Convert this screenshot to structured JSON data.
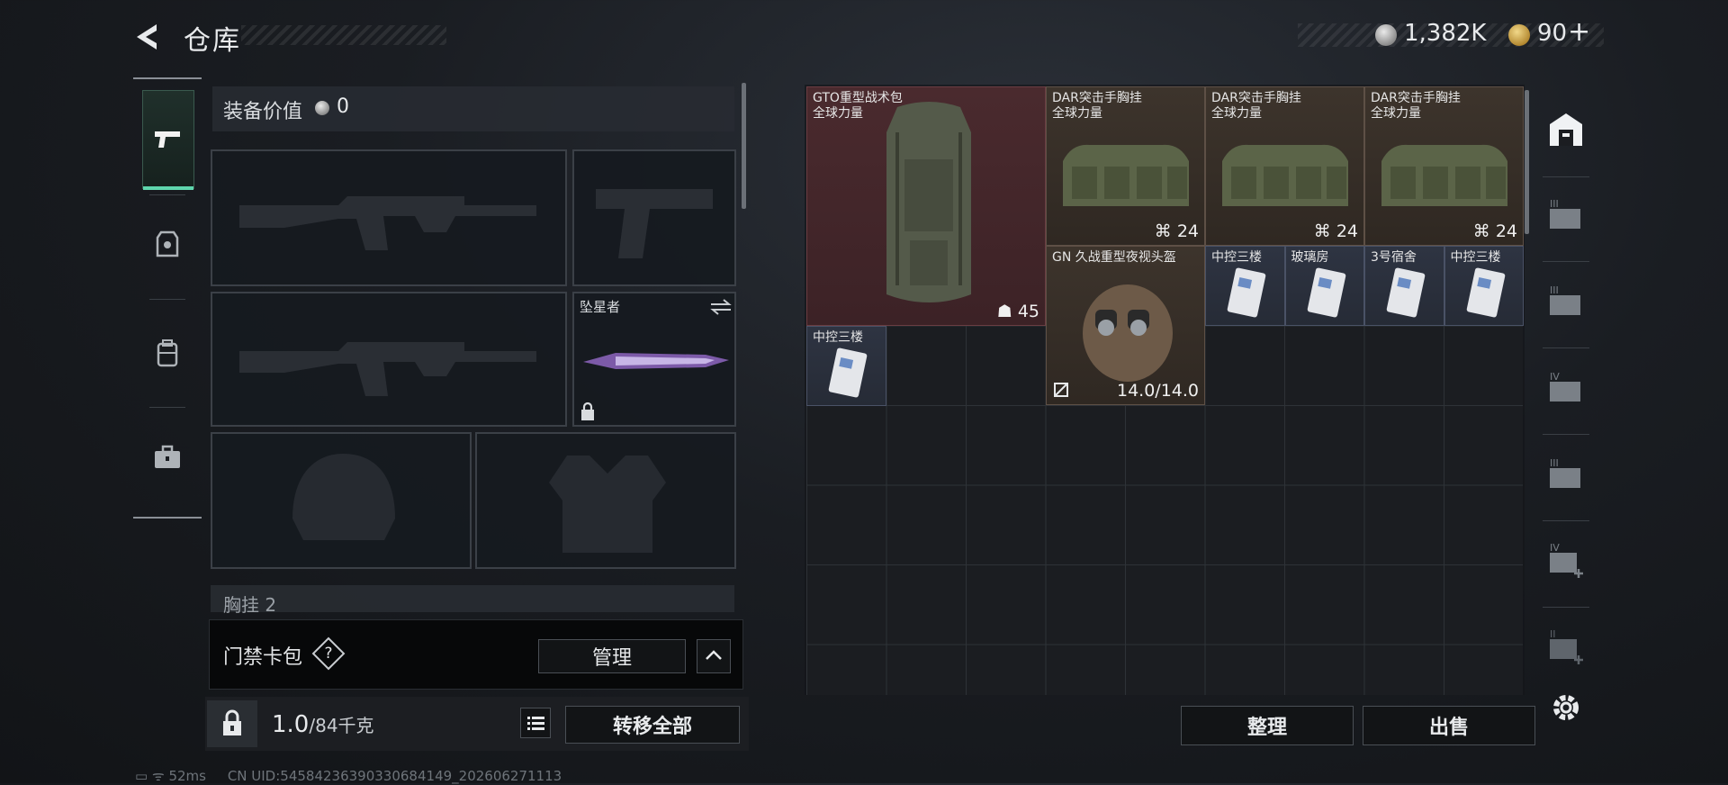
{
  "header": {
    "title": "仓库",
    "silver_amount": "1,382K",
    "gold_amount": "90",
    "plus_label": "+"
  },
  "equipment": {
    "value_label": "装备价值",
    "value_amount": "0",
    "melee_slot_name": "坠星者",
    "chest_rig_peek": "胸挂 2"
  },
  "keycard": {
    "label": "门禁卡包",
    "help": "?",
    "manage_label": "管理"
  },
  "footer_left": {
    "weight_current": "1.0",
    "weight_max": "/84千克",
    "transfer_all_label": "转移全部"
  },
  "stash": {
    "items": [
      {
        "name": "GTO重型战术包",
        "sub": "全球力量",
        "count": "45"
      },
      {
        "name": "DAR突击手胸挂",
        "sub": "全球力量",
        "count": "24"
      },
      {
        "name": "DAR突击手胸挂",
        "sub": "全球力量",
        "count": "24"
      },
      {
        "name": "DAR突击手胸挂",
        "sub": "全球力量",
        "count": "24"
      },
      {
        "name": "GN 久战重型夜视头盔",
        "sub": "",
        "count": "14.0/14.0"
      },
      {
        "name": "中控三楼",
        "sub": "",
        "count": ""
      },
      {
        "name": "玻璃房",
        "sub": "",
        "count": ""
      },
      {
        "name": "3号宿舍",
        "sub": "",
        "count": ""
      },
      {
        "name": "中控三楼",
        "sub": "",
        "count": ""
      },
      {
        "name": "中控三楼",
        "sub": "",
        "count": ""
      }
    ],
    "sort_label": "整理",
    "sell_label": "出售"
  },
  "status_bar": {
    "ping": "52ms",
    "uid": "CN UID:545842363903306841​49_202606271113"
  },
  "colors": {
    "accent": "#5fd6ad",
    "rare_red": "#4a2a2e",
    "brown": "#3d342c",
    "card": "#2e3442"
  }
}
